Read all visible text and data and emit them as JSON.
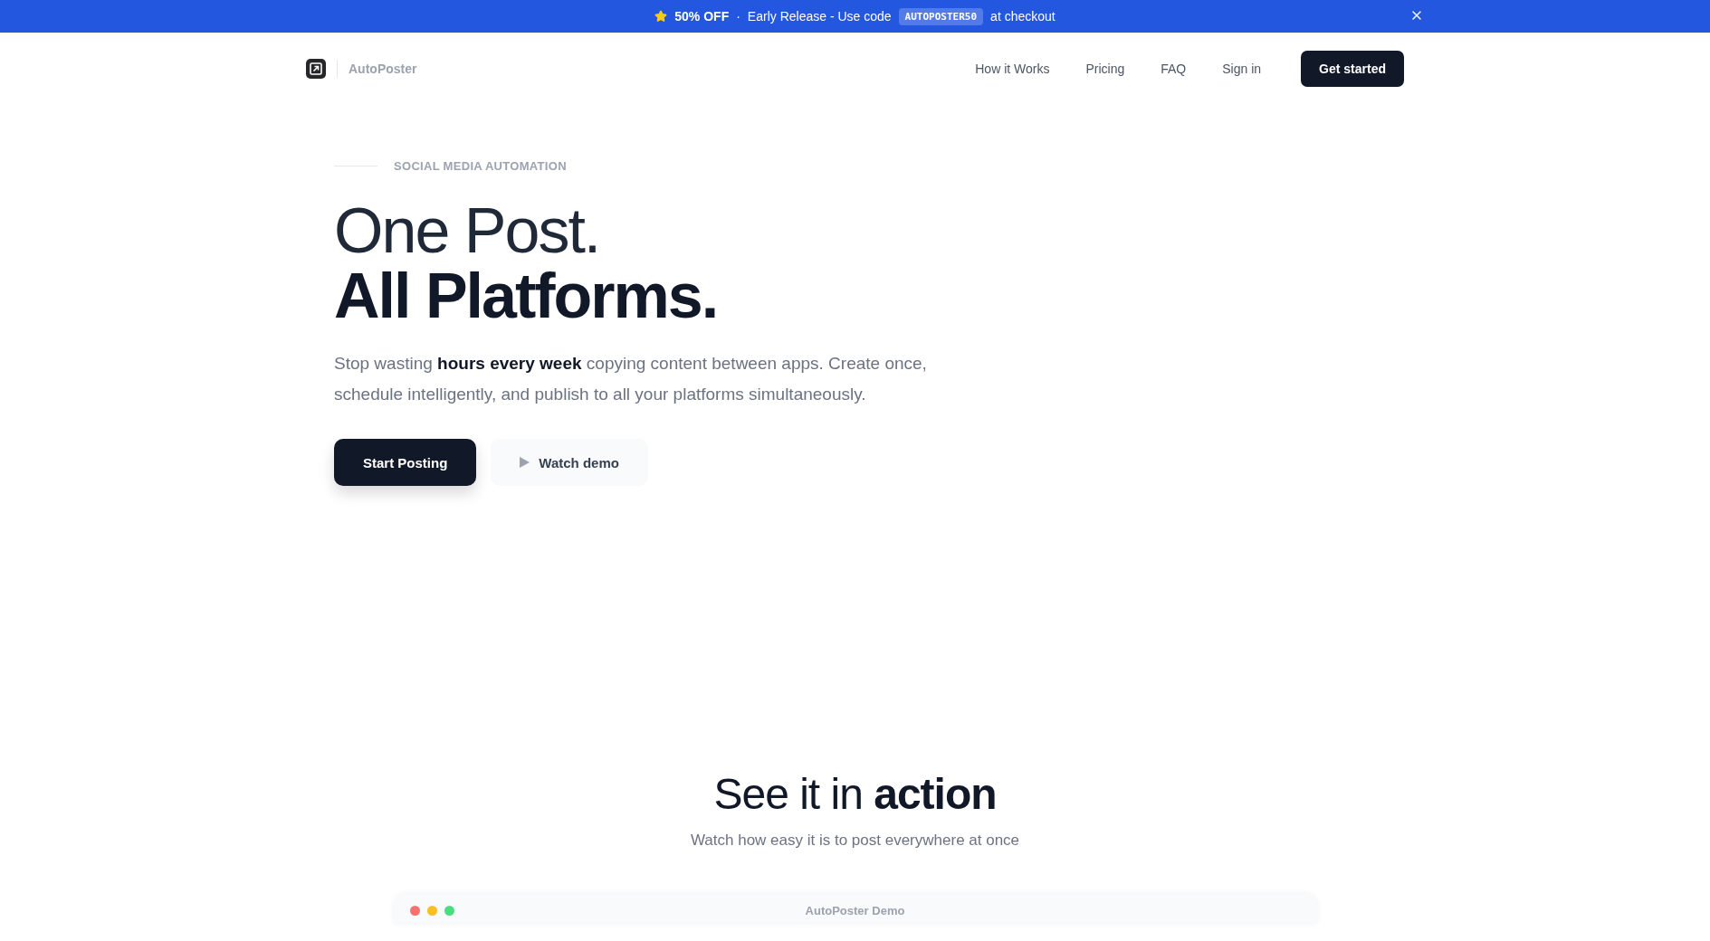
{
  "banner": {
    "highlight": "50% OFF",
    "separator": "·",
    "text": "Early Release - Use code",
    "code": "AUTOPOSTER50",
    "after": "at checkout"
  },
  "nav": {
    "brand": "AutoPoster",
    "links": [
      "How it Works",
      "Pricing",
      "FAQ",
      "Sign in"
    ],
    "cta": "Get started"
  },
  "hero": {
    "eyebrow": "SOCIAL MEDIA AUTOMATION",
    "title_light": "One Post.",
    "title_bold": "All Platforms.",
    "lead": "Stop wasting **hours every week** copying content between apps. Create once, schedule intelligently, and publish to all your platforms simultaneously.",
    "primary": "Start Posting",
    "secondary": "Watch demo"
  },
  "demo": {
    "title_light": "See it in",
    "title_bold": "action",
    "subtitle": "Watch how easy it is to post everywhere at once",
    "window_title": "AutoPoster Demo",
    "dots": [
      {
        "color": "#f87171"
      },
      {
        "color": "#fbbf24"
      },
      {
        "color": "#4ade80"
      }
    ]
  }
}
